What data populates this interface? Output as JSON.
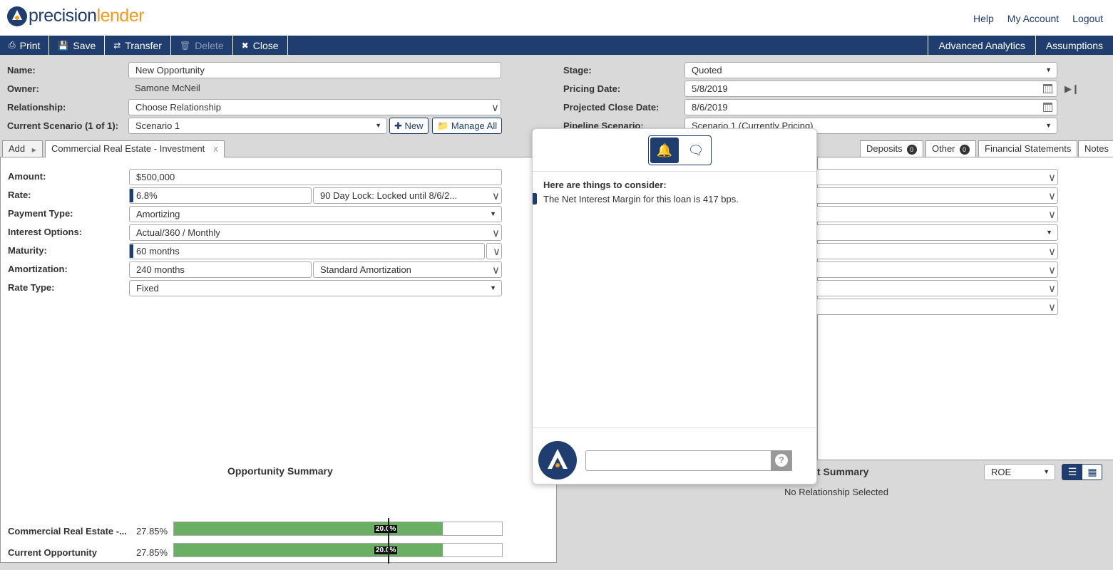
{
  "brand": {
    "part1": "precision",
    "part2": "lender"
  },
  "top_links": [
    "Help",
    "My Account",
    "Logout"
  ],
  "toolbar": {
    "print": "Print",
    "save": "Save",
    "transfer": "Transfer",
    "delete": "Delete",
    "close": "Close",
    "advanced": "Advanced Analytics",
    "assumptions": "Assumptions"
  },
  "header": {
    "name_label": "Name:",
    "name_value": "New Opportunity",
    "owner_label": "Owner:",
    "owner_value": "Samone McNeil",
    "relationship_label": "Relationship:",
    "relationship_value": "Choose Relationship",
    "scenario_label": "Current Scenario (1 of 1):",
    "scenario_value": "Scenario 1",
    "new_btn": "New",
    "manage_btn": "Manage All",
    "stage_label": "Stage:",
    "stage_value": "Quoted",
    "pricing_label": "Pricing Date:",
    "pricing_value": "5/8/2019",
    "close_label": "Projected Close Date:",
    "close_value": "8/6/2019",
    "pipeline_label": "Pipeline Scenario:",
    "pipeline_value": "Scenario 1 (Currently Pricing)"
  },
  "tabs": {
    "add": "Add",
    "loan": "Commercial Real Estate - Investment",
    "loan_close": "x",
    "deposits": "Deposits",
    "deposits_count": "0",
    "other": "Other",
    "other_count": "0",
    "financials": "Financial Statements",
    "notes": "Notes"
  },
  "loan": {
    "amount_label": "Amount:",
    "amount": "$500,000",
    "rate_label": "Rate:",
    "rate": "6.8%",
    "rate_lock": "90 Day Lock: Locked until 8/6/2...",
    "payment_label": "Payment Type:",
    "payment": "Amortizing",
    "interest_label": "Interest Options:",
    "interest": "Actual/360 / Monthly",
    "maturity_label": "Maturity:",
    "maturity": "60 months",
    "amort_label": "Amortization:",
    "amort": "240 months",
    "amort_type": "Standard Amortization",
    "ratetype_label": "Rate Type:",
    "ratetype": "Fixed"
  },
  "summary": {
    "title": "Opportunity Summary",
    "rows": [
      {
        "label": "Commercial Real Estate -...",
        "value": "27.85%",
        "fill": 0.82,
        "target": "20.0%"
      },
      {
        "label": "Current Opportunity",
        "value": "27.85%",
        "fill": 0.82,
        "target": "20.0%"
      }
    ]
  },
  "relationship_summary": {
    "title": "Relationship Summary",
    "title_visible": "t Summary",
    "metric": "ROE",
    "empty": "No Relationship Selected"
  },
  "popup": {
    "heading": "Here are things to consider:",
    "message": "The Net Interest Margin for this loan is 417 bps.",
    "input_placeholder": "",
    "help": "?"
  },
  "colors": {
    "navy": "#1f3d6e",
    "orange": "#f39a1e",
    "green": "#6aaf63"
  }
}
